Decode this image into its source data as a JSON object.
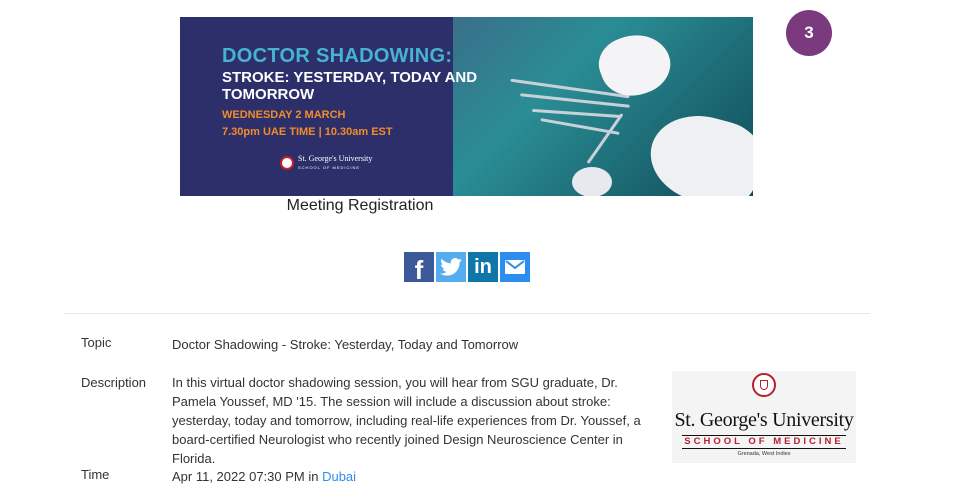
{
  "banner": {
    "title_line1": "DOCTOR SHADOWING:",
    "title_line2": "STROKE: YESTERDAY, TODAY AND TOMORROW",
    "date": "WEDNESDAY 2 MARCH",
    "time": "7.30pm UAE TIME | 10.30am EST",
    "logo_name": "St. George's University",
    "logo_sub": "SCHOOL OF MEDICINE"
  },
  "badge": {
    "count": "3"
  },
  "page_title": "Meeting Registration",
  "share": {
    "facebook_glyph": "f",
    "linkedin_glyph": "in",
    "icons": [
      "facebook-icon",
      "twitter-icon",
      "linkedin-icon",
      "email-icon"
    ]
  },
  "details": {
    "topic_label": "Topic",
    "topic_value": "Doctor Shadowing - Stroke: Yesterday, Today and Tomorrow",
    "description_label": "Description",
    "description_value": "In this virtual doctor shadowing session, you will hear from SGU graduate, Dr. Pamela Youssef, MD '15. The session will include a discussion about stroke: yesterday, today and tomorrow, including real-life experiences from Dr. Youssef, a board-certified Neurologist who recently joined Design Neuroscience Center in Florida.",
    "time_label": "Time",
    "time_value": "Apr 11, 2022 07:30 PM in ",
    "time_zone_link": "Dubai"
  },
  "sgu_logo": {
    "name": "St. George's University",
    "school": "SCHOOL OF MEDICINE",
    "location": "Grenada, West Indies"
  },
  "colors": {
    "banner_bg": "#2d2f6b",
    "banner_title": "#47b4cf",
    "banner_accent": "#f28c2a",
    "badge": "#7b3a7d",
    "link": "#2d8cf0",
    "sgu_red": "#b5212e"
  }
}
